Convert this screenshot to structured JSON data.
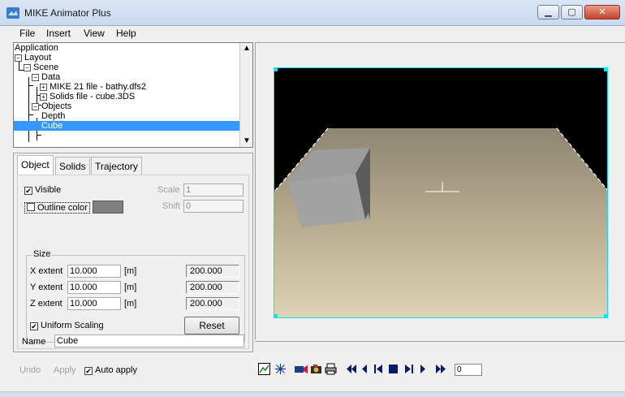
{
  "window": {
    "title": "MIKE Animator Plus"
  },
  "menu": [
    "File",
    "Insert",
    "View",
    "Help"
  ],
  "tree": {
    "root": "Application",
    "layout": "Layout",
    "scene": "Scene",
    "data": "Data",
    "mike21": "MIKE 21 file - bathy.dfs2",
    "solids": "Solids file - cube.3DS",
    "objects": "Objects",
    "depth": "Depth",
    "cube": "Cube"
  },
  "tabs": [
    "Object",
    "Solids",
    "Trajectory"
  ],
  "object_tab": {
    "visible_label": "Visible",
    "visible_checked": true,
    "outline_label": "Outline color",
    "outline_checked": false,
    "outline_color": "#808080",
    "scale_label": "Scale",
    "scale_value": "1",
    "shift_label": "Shift",
    "shift_value": "0",
    "size_group": "Size",
    "x_label": "X extent",
    "x_value": "10.000",
    "x_unit": "[m]",
    "x_abs": "200.000",
    "y_label": "Y extent",
    "y_value": "10.000",
    "y_unit": "[m]",
    "y_abs": "200.000",
    "z_label": "Z extent",
    "z_value": "10.000",
    "z_unit": "[m]",
    "z_abs": "200.000",
    "uniform_label": "Uniform Scaling",
    "uniform_checked": true,
    "reset_label": "Reset",
    "name_label": "Name",
    "name_value": "Cube"
  },
  "footer": {
    "undo": "Undo",
    "apply": "Apply",
    "auto_apply": "Auto apply",
    "auto_apply_checked": true
  },
  "toolbar": {
    "frame_value": "0",
    "icons": [
      "chart-icon",
      "asterisk-icon",
      "video-camera-icon",
      "camera-icon",
      "print-icon",
      "rewind-icon",
      "step-back-icon",
      "go-start-icon",
      "stop-icon",
      "go-end-icon",
      "step-forward-icon",
      "fast-forward-icon"
    ]
  },
  "colors": {
    "selection": "#3399ff",
    "viewport_border": "#00e5ee"
  }
}
